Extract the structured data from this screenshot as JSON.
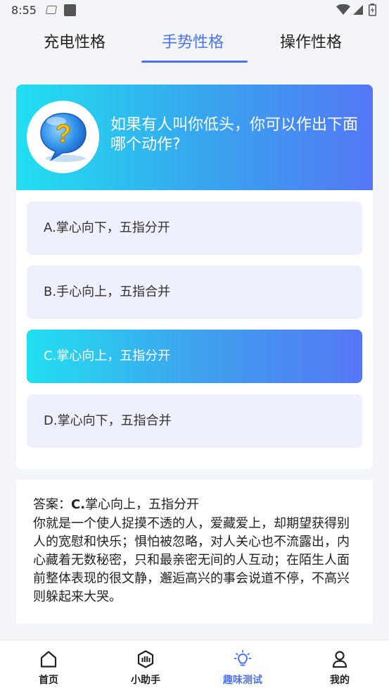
{
  "status_bar": {
    "time": "8:55"
  },
  "tabs": [
    {
      "label": "充电性格",
      "active": false
    },
    {
      "label": "手势性格",
      "active": true
    },
    {
      "label": "操作性格",
      "active": false
    }
  ],
  "question": {
    "icon": "question-bubble-icon",
    "text": "如果有人叫你低头，你可以作出下面哪个动作?"
  },
  "options": [
    {
      "label": "A.掌心向下，五指分开",
      "selected": false
    },
    {
      "label": "B.手心向上，五指合并",
      "selected": false
    },
    {
      "label": "C.掌心向上，五指分开",
      "selected": true
    },
    {
      "label": "D.掌心向下，五指合并",
      "selected": false
    }
  ],
  "answer": {
    "prefix": "答案：",
    "letter": "C.",
    "choice": "掌心向上，五指分开",
    "description": "你就是一个使人捉摸不透的人，爱藏爱上，却期望获得别人的宽慰和快乐；惧怕被忽略，对人关心也不流露出，内心藏着无数秘密，只和最亲密无间的人互动；在陌生人面前整体表现的很文静，邂逅高兴的事会说道不停，不高兴则躲起来大哭。"
  },
  "bottom_nav": [
    {
      "label": "首页",
      "icon": "home-icon"
    },
    {
      "label": "小助手",
      "icon": "assistant-icon"
    },
    {
      "label": "趣味测试",
      "icon": "lightbulb-icon",
      "active": true
    },
    {
      "label": "我的",
      "icon": "profile-icon"
    }
  ],
  "colors": {
    "accent": "#4b73f0",
    "gradient_start": "#21e0f0",
    "gradient_end": "#5477f5",
    "option_bg": "#eef0fc"
  }
}
